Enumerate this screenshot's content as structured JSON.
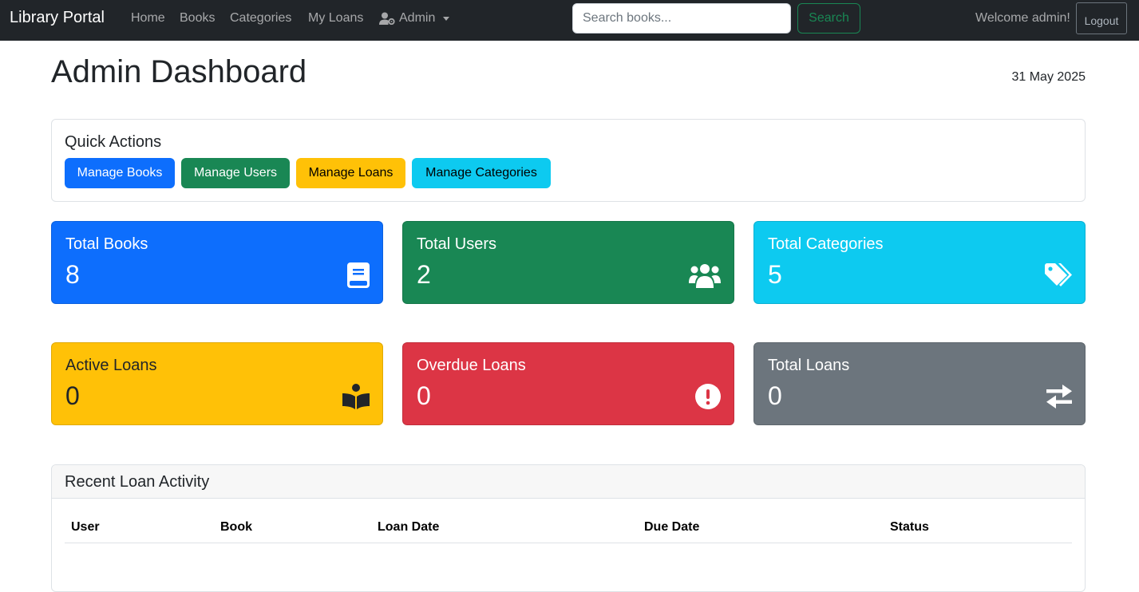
{
  "navbar": {
    "brand": "Library Portal",
    "links": {
      "home": "Home",
      "books": "Books",
      "categories": "Categories",
      "my_loans": "My Loans"
    },
    "admin_label": "Admin",
    "search": {
      "placeholder": "Search books...",
      "value": ""
    },
    "search_label": "Search",
    "welcome": "Welcome admin!",
    "logout_label": "Logout"
  },
  "header": {
    "title": "Admin Dashboard",
    "date": "31 May 2025"
  },
  "quick_actions": {
    "title": "Quick Actions",
    "buttons": {
      "books": "Manage Books",
      "users": "Manage Users",
      "loans": "Manage Loans",
      "categories": "Manage Categories"
    }
  },
  "stats": {
    "total_books": {
      "label": "Total Books",
      "value": "8",
      "icon": "book-icon",
      "color": "#0d6efd"
    },
    "total_users": {
      "label": "Total Users",
      "value": "2",
      "icon": "users-icon",
      "color": "#198754"
    },
    "total_categories": {
      "label": "Total Categories",
      "value": "5",
      "icon": "tags-icon",
      "color": "#0dcaf0"
    },
    "active_loans": {
      "label": "Active Loans",
      "value": "0",
      "icon": "book-reader-icon",
      "color": "#ffc107"
    },
    "overdue_loans": {
      "label": "Overdue Loans",
      "value": "0",
      "icon": "exclamation-circle-icon",
      "color": "#dc3545"
    },
    "total_loans": {
      "label": "Total Loans",
      "value": "0",
      "icon": "exchange-icon",
      "color": "#6c757d"
    }
  },
  "recent_activity": {
    "title": "Recent Loan Activity",
    "columns": {
      "user": "User",
      "book": "Book",
      "loan_date": "Loan Date",
      "due_date": "Due Date",
      "status": "Status"
    },
    "rows": []
  }
}
